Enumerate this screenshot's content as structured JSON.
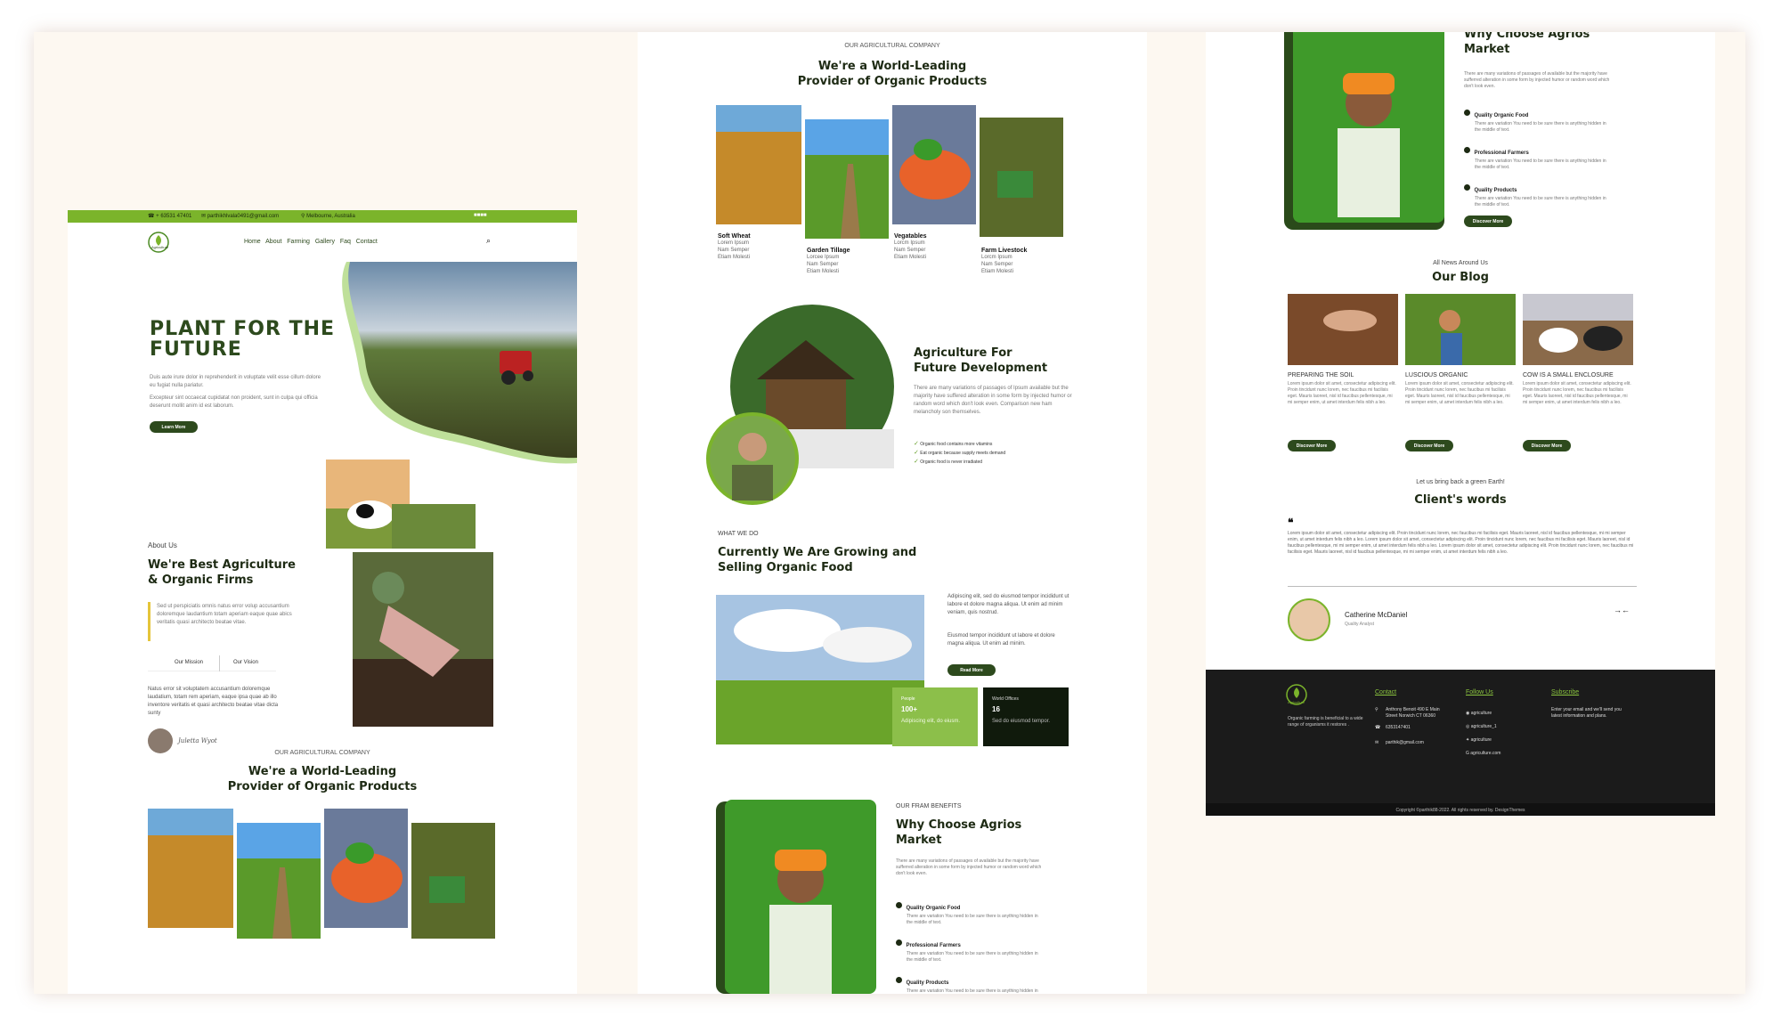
{
  "topbar": {
    "phone": "+ 63531 47401",
    "email": "parthikhlvala0491@gmail.com",
    "location": "Melbourne, Australia"
  },
  "nav": {
    "logo": "Agriculture",
    "items": [
      "Home",
      "About",
      "Farming",
      "Gallery",
      "Faq",
      "Contact"
    ]
  },
  "hero": {
    "title_line1": "PLANT FOR THE",
    "title_line2": "FUTURE",
    "p1": "Duis aute irure dolor in reprehenderit in voluptate velit esse cillum dolore eu fugiat nulla pariatur.",
    "p2": "Excepteur sint occaecat cupidatat non proident, sunt in culpa qui officia deserunt mollit anim id est laborum.",
    "button": "Learn More"
  },
  "about": {
    "eyebrow": "About Us",
    "title_line1": "We're Best Agriculture",
    "title_line2": "& Organic Firms",
    "quote": "Sed ut perspiciatis omnis natus error volup accusantium doloremque laudantium totam aperiam eaque quae abics veritatis quasi architecto beatae vitae.",
    "tab1": "Our Mission",
    "tab2": "Our Vision",
    "body": "Natus error sit voluptatem accusantium doloremque laudatium, totam rem aperiam, eaque ipsa quae ab illo inventore veritatis et quasi architecto beatae vitae dicta sunty",
    "signature": "Juletta Wyot"
  },
  "products": {
    "eyebrow": "OUR AGRICULTURAL COMPANY",
    "title_line1": "We're a World-Leading",
    "title_line2": "Provider of Organic Products",
    "cards": [
      {
        "name": "Soft Wheat",
        "items": [
          "Lorem Ipsum",
          "Nam Semper",
          "Etiam Molesti"
        ]
      },
      {
        "name": "Garden Tillage",
        "items": [
          "Lorcee Ipsum",
          "Nam Semper",
          "Etiam Molesti"
        ]
      },
      {
        "name": "Vegatables",
        "items": [
          "Lorcm Ipsum",
          "Nam Semper",
          "Etiam Molesti"
        ]
      },
      {
        "name": "Farm Livestock",
        "items": [
          "Lorcm Ipsum",
          "Nam Semper",
          "Etiam Molesti"
        ]
      }
    ]
  },
  "future": {
    "title_line1": "Agriculture For",
    "title_line2": "Future Development",
    "body": "There are many variations of passages of Ipsum available but the majority have suffered alteration in some form by injected humor or random word which don't look even. Comparison new ham melancholy son themselves.",
    "checks": [
      "Organic food contains more vitamins",
      "Eat organic because supply meets demand",
      "Organic food is never irradiated"
    ]
  },
  "growing": {
    "eyebrow": "WHAT WE DO",
    "title_line1": "Currently We Are Growing and",
    "title_line2": "Selling Organic Food",
    "p1": "Adipiscing elit, sed do eiusmod tempor incididunt ut labore et dolore magna aliqua. Ut enim ad minim veniam, quis nostrud.",
    "p2": "Eiusmod tempor incididunt ut labore et dolore magna aliqua. Ut enim ad minim.",
    "button": "Read More",
    "stat1_label": "People",
    "stat1_value": "100+",
    "stat1_text": "Adipiscing elit, do eiusm.",
    "stat2_label": "World Offices",
    "stat2_value": "16",
    "stat2_text": "Sed do eiusmod tempor."
  },
  "why": {
    "eyebrow": "OUR FRAM BENEFITS",
    "title_line1": "Why Choose Agrios",
    "title_line2": "Market",
    "body": "There are many variations of passages of available but the majority have sufferred alteration in some form by injected humor or random word which don't look even.",
    "items": [
      {
        "title": "Quality Organic Food",
        "text": "There are variation You need to be sure there is anything hidden in the middle of text."
      },
      {
        "title": "Professional Farmers",
        "text": "There are variation You need to be sure there is anything hidden in the middle of text."
      },
      {
        "title": "Quality Products",
        "text": "There are variation You need to be sure there is anything hidden in the middle of text."
      }
    ],
    "button": "Discover More"
  },
  "blog": {
    "eyebrow": "All News Around Us",
    "title": "Our Blog",
    "posts": [
      {
        "title": "PREPARING THE SOIL",
        "text": "Lorem ipsum dolor sit amet, consectetur adipiscing elit. Proin tincidunt nunc lorem, nec faucibus mi facilisis eget. Mauris laoreet, nisl id faucibus pellentesque, mi mi semper enim, ut amet interdum felis nibh a leo.",
        "button": "Discover More"
      },
      {
        "title": "LUSCIOUS ORGANIC",
        "text": "Lorem ipsum dolor sit amet, consectetur adipiscing elit. Proin tincidunt nunc lorem, nec faucibus mi facilisis eget. Mauris laoreet, nisl id faucibus pellentesque, mi mi semper enim, ut amet interdum felis nibh a leo.",
        "button": "Discover More"
      },
      {
        "title": "COW IS A SMALL ENCLOSURE",
        "text": "Lorem ipsum dolor sit amet, consectetur adipiscing elit. Proin tincidunt nunc lorem, nec faucibus mi facilisis eget. Mauris laoreet, nisl id faucibus pellentesque, mi mi semper enim, ut amet interdum felis nibh a leo.",
        "button": "Discover More"
      }
    ]
  },
  "clients": {
    "eyebrow": "Let us bring back a green Earth!",
    "title": "Client's words",
    "quote": "Lorem ipsum dolor sit amet, consectetur adipiscing elit. Proin tincidunt nunc lorem, nec faucibus mi facilisis eget. Mauris laoreet, nisl id faucibus pellentesque, mi mi semper enim, ut amet interdum felis nibh a leo. Lorem ipsum dolor sit amet, consectetur adipiscing elit. Proin tincidunt nunc lorem, nec faucibus mi facilisis eget. Mauris laoreet, nisl id faucibus pellentesque, mi mi semper enim, ut amet interdum felis nibh a leo. Lorem ipsum dolor sit amet, consectetur adipiscing elit. Proin tincidunt nunc lorem, nec faucibus mi facilisis eget. Mauris laoreet, nisl id faucibus pellentesque, mi mi semper enim, ut amet interdum felis nibh a leo.",
    "name": "Catherine McDaniel",
    "role": "Quality Analyst"
  },
  "footer": {
    "logo": "Agriculture",
    "about": "Organic farming is beneficial to a wide range of organisms it restores .",
    "contact_title": "Contact",
    "address": "Anthony Benoit 490 E Main Street Norwich CT 06360",
    "phone": "6353147401",
    "email": "parthik@gmail.com",
    "follow_title": "Follow Us",
    "follow": [
      "agriculture",
      "agriculture_1",
      "agriculture",
      "agriculture.com"
    ],
    "subscribe_title": "Subscribe",
    "subscribe_text": "Enter your email and we'll send you latest information and plans.",
    "copyright": "Copyright ©parthik88-2022. All rights reserved by. DesignThemes"
  },
  "colors": {
    "accent": "#7bb42b",
    "dark_green": "#2d4a1d",
    "footer": "#1b1b1b"
  }
}
